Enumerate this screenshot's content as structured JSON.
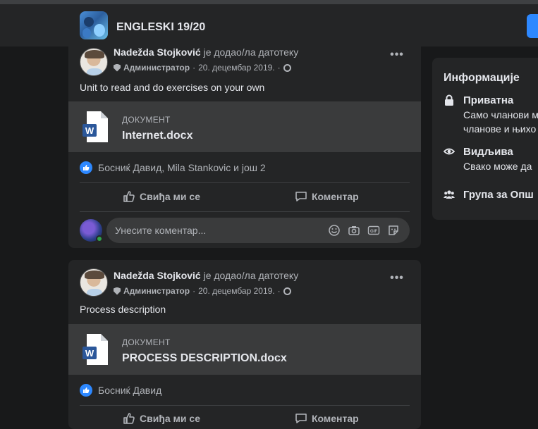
{
  "header": {
    "group_name": "ENGLESKI 19/20"
  },
  "posts": [
    {
      "author": "Nadežda Stojković",
      "action": "је додао/ла датотеку",
      "role": "Администратор",
      "date": "20. децембар 2019.",
      "separator": "·",
      "text": "Unit to read and do exercises on your own",
      "doc_kind": "ДОКУМЕНТ",
      "doc_name": "Internet.docx",
      "reactors": "Босниќ Давид, Mila Stankovic и још 2",
      "like_label": "Свиђа ми се",
      "comment_label": "Коментар",
      "comment_placeholder": "Унесите коментар..."
    },
    {
      "author": "Nadežda Stojković",
      "action": "је додао/ла датотеку",
      "role": "Администратор",
      "date": "20. децембар 2019.",
      "separator": "·",
      "text": "Process description",
      "doc_kind": "ДОКУМЕНТ",
      "doc_name": "PROCESS DESCRIPTION.docx",
      "reactors": "Босниќ Давид",
      "like_label": "Свиђа ми се",
      "comment_label": "Коментар"
    }
  ],
  "info": {
    "title": "Информације",
    "private_title": "Приватна",
    "private_text_1": "Само чланови м",
    "private_text_2": "чланове и њихо",
    "visible_title": "Видљива",
    "visible_text": "Свако може да",
    "group_link": "Група за Опш"
  },
  "colors": {
    "accent": "#2d88ff",
    "card": "#242526",
    "background": "#18191a",
    "doc_bg": "#3a3b3c",
    "online": "#31a24c"
  }
}
